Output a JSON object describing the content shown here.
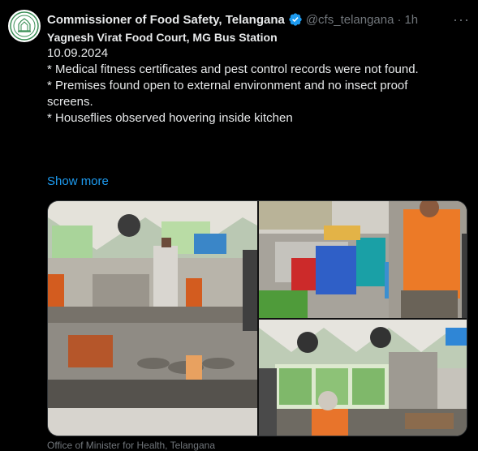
{
  "post": {
    "display_name": "Commissioner of Food Safety, Telangana",
    "handle": "@cfs_telangana",
    "separator": "·",
    "time": "1h",
    "more_glyph": "···",
    "verified_color": "#1d9bf0"
  },
  "body": {
    "line1": "Yagnesh Virat Food Court, MG Bus Station",
    "line2": "10.09.2024",
    "line3": "* Medical fitness certificates and pest control records were not found.",
    "line4": "* Premises found open to external environment and no insect proof",
    "line5": "screens.",
    "line6": "* Houseflies observed hovering inside kitchen",
    "show_more": "Show more"
  },
  "media": {
    "photos": [
      {
        "subject": "kitchen counter with cooking equipment and staff"
      },
      {
        "subject": "colored buckets and waste bins area with worker in orange shirt"
      },
      {
        "subject": "kitchen with exhaust fans and cook in orange shirt"
      }
    ]
  },
  "source": {
    "label": "Office of Minister for Health, Telangana"
  }
}
